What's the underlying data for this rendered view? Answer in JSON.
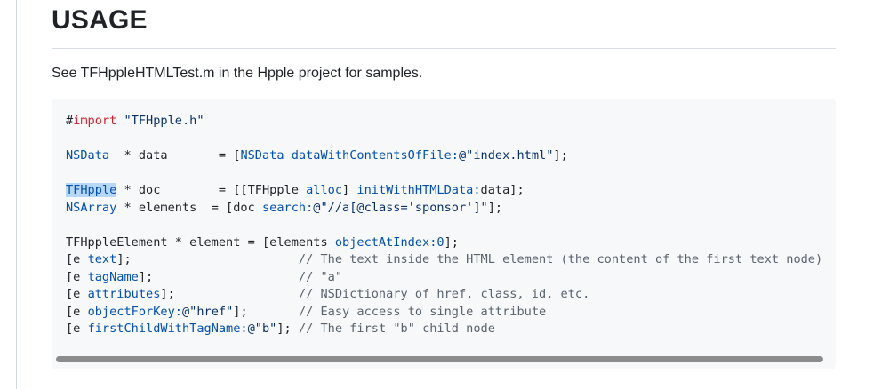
{
  "section": {
    "heading": "USAGE",
    "description": "See TFHppleHTMLTest.m in the Hpple project for samples."
  },
  "code": {
    "language": "objective-c",
    "lines": [
      [
        {
          "t": "#",
          "c": "plain"
        },
        {
          "t": "import",
          "c": "keyword"
        },
        {
          "t": " ",
          "c": "plain"
        },
        {
          "t": "\"TFHpple.h\"",
          "c": "string"
        }
      ],
      [],
      [
        {
          "t": "NSData",
          "c": "type"
        },
        {
          "t": "  * data       = [",
          "c": "plain"
        },
        {
          "t": "NSData",
          "c": "type"
        },
        {
          "t": " ",
          "c": "plain"
        },
        {
          "t": "dataWithContentsOfFile:",
          "c": "method"
        },
        {
          "t": "@\"index.html\"",
          "c": "string"
        },
        {
          "t": "];",
          "c": "plain"
        }
      ],
      [],
      [
        {
          "t": "TFHpple",
          "c": "type-hl"
        },
        {
          "t": " * doc        = [[TFHpple ",
          "c": "plain"
        },
        {
          "t": "alloc",
          "c": "method"
        },
        {
          "t": "] ",
          "c": "plain"
        },
        {
          "t": "initWithHTMLData:",
          "c": "method"
        },
        {
          "t": "data];",
          "c": "plain"
        }
      ],
      [
        {
          "t": "NSArray",
          "c": "type"
        },
        {
          "t": " * elements  = [doc ",
          "c": "plain"
        },
        {
          "t": "search:",
          "c": "method"
        },
        {
          "t": "@\"//a[@class='sponsor']\"",
          "c": "string"
        },
        {
          "t": "];",
          "c": "plain"
        }
      ],
      [],
      [
        {
          "t": "TFHppleElement * element = [elements ",
          "c": "plain"
        },
        {
          "t": "objectAtIndex:",
          "c": "method"
        },
        {
          "t": "0",
          "c": "number"
        },
        {
          "t": "];",
          "c": "plain"
        }
      ],
      [
        {
          "t": "[e ",
          "c": "plain"
        },
        {
          "t": "text",
          "c": "method"
        },
        {
          "t": "];                       ",
          "c": "plain"
        },
        {
          "t": "// The text inside the HTML element (the content of the first text node)",
          "c": "comment"
        }
      ],
      [
        {
          "t": "[e ",
          "c": "plain"
        },
        {
          "t": "tagName",
          "c": "method"
        },
        {
          "t": "];                    ",
          "c": "plain"
        },
        {
          "t": "// \"a\"",
          "c": "comment"
        }
      ],
      [
        {
          "t": "[e ",
          "c": "plain"
        },
        {
          "t": "attributes",
          "c": "method"
        },
        {
          "t": "];                 ",
          "c": "plain"
        },
        {
          "t": "// NSDictionary of href, class, id, etc.",
          "c": "comment"
        }
      ],
      [
        {
          "t": "[e ",
          "c": "plain"
        },
        {
          "t": "objectForKey:",
          "c": "method"
        },
        {
          "t": "@\"href\"",
          "c": "string"
        },
        {
          "t": "];       ",
          "c": "plain"
        },
        {
          "t": "// Easy access to single attribute",
          "c": "comment"
        }
      ],
      [
        {
          "t": "[e ",
          "c": "plain"
        },
        {
          "t": "firstChildWithTagName:",
          "c": "method"
        },
        {
          "t": "@\"b\"",
          "c": "string"
        },
        {
          "t": "]; ",
          "c": "plain"
        },
        {
          "t": "// The first \"b\" child node",
          "c": "comment"
        }
      ]
    ]
  },
  "colors": {
    "keyword": "#cf222e",
    "string": "#0a3069",
    "type": "#0550ae",
    "comment": "#59636e",
    "selection": "#b6d7f8",
    "code_background": "#f6f8fa"
  },
  "scrollbar": {
    "orientation": "horizontal",
    "visible_fraction": 0.98
  }
}
